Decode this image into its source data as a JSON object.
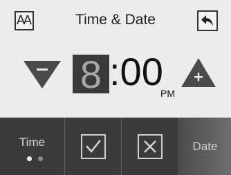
{
  "header": {
    "title": "Time & Date",
    "font_icon": "font-size-icon",
    "font_glyph": "AA",
    "back_icon": "back-arrow-icon"
  },
  "clock": {
    "hour": "8",
    "minutes": ":00",
    "period": "PM",
    "decrement_icon": "down-triangle-minus-icon",
    "increment_icon": "up-triangle-plus-icon"
  },
  "bottom_bar": {
    "time_label": "Time",
    "page_indicator": {
      "total": 2,
      "active": 1
    },
    "confirm_icon": "checkmark-icon",
    "cancel_icon": "close-x-icon",
    "date_label": "Date"
  },
  "colors": {
    "background": "#ececec",
    "bar": "#3b3b3b",
    "arrow": "#4a4a4a",
    "hour_highlight": "#3a3a3a"
  }
}
